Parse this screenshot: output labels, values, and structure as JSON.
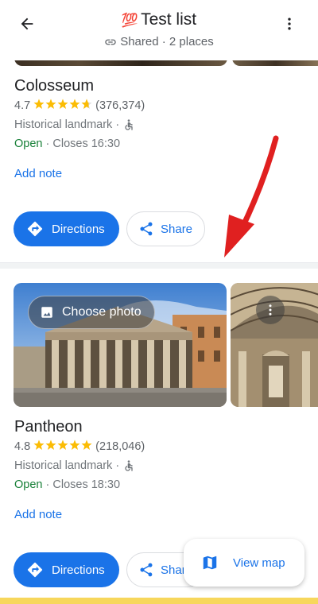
{
  "header": {
    "title_emoji": "💯",
    "title": "Test list",
    "subtitle": "Shared · 2 places",
    "back_icon": "arrow-left-icon",
    "more_icon": "more-vert-icon",
    "shared_icon": "link-icon"
  },
  "places": [
    {
      "name": "Colosseum",
      "rating": "4.7",
      "stars_filled": 4.7,
      "reviews": "(376,374)",
      "category": "Historical landmark ·",
      "open_status": "Open",
      "hours": "· Closes 16:30",
      "add_note": "Add note",
      "directions_label": "Directions",
      "share_label": "Share"
    },
    {
      "name": "Pantheon",
      "rating": "4.8",
      "stars_filled": 4.8,
      "reviews": "(218,046)",
      "category": "Historical landmark ·",
      "open_status": "Open",
      "hours": "· Closes 18:30",
      "add_note": "Add note",
      "directions_label": "Directions",
      "share_label": "Share",
      "choose_photo_label": "Choose photo"
    }
  ],
  "view_map_label": "View map",
  "colors": {
    "accent": "#1a73e8",
    "open": "#188038",
    "star": "#fbbc04",
    "annotation_arrow": "#e02020"
  }
}
